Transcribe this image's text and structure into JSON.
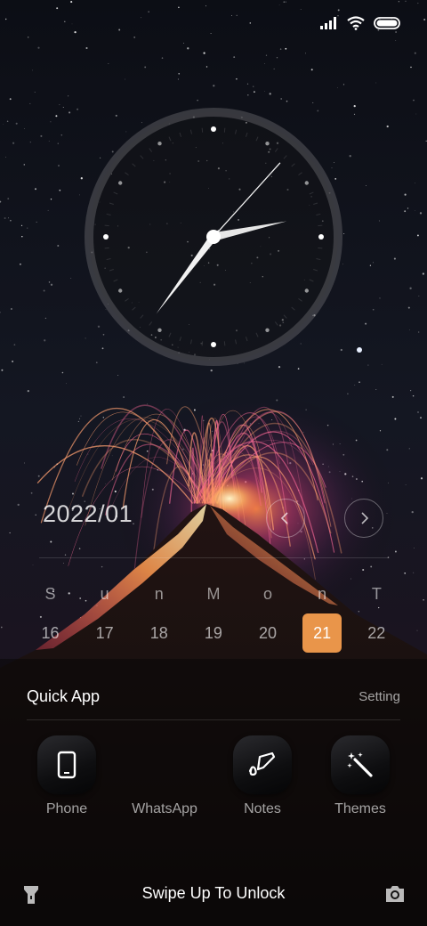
{
  "status_bar": {
    "icons": [
      "signal-icon",
      "wifi-icon",
      "battery-icon"
    ]
  },
  "clock": {
    "hour": 2,
    "minute": 36,
    "second": 7
  },
  "calendar": {
    "month": "2022/01",
    "weekdays": [
      "S",
      "u",
      "n",
      "M",
      "o",
      "n",
      "T"
    ],
    "dates": [
      "16",
      "17",
      "18",
      "19",
      "20",
      "21",
      "22"
    ],
    "today": "21",
    "accent_color": "#e9954a",
    "prev_icon": "chevron-left-icon",
    "next_icon": "chevron-right-icon"
  },
  "quick_apps": {
    "title": "Quick App",
    "setting_label": "Setting",
    "apps": [
      {
        "label": "Phone",
        "icon": "phone-icon"
      },
      {
        "label": "WhatsApp",
        "icon": ""
      },
      {
        "label": "Notes",
        "icon": "notes-pen-icon"
      },
      {
        "label": "Themes",
        "icon": "magic-wand-icon"
      }
    ]
  },
  "bottom_bar": {
    "unlock_text": "Swipe Up To Unlock",
    "left_icon": "flashlight-icon",
    "right_icon": "camera-icon"
  }
}
